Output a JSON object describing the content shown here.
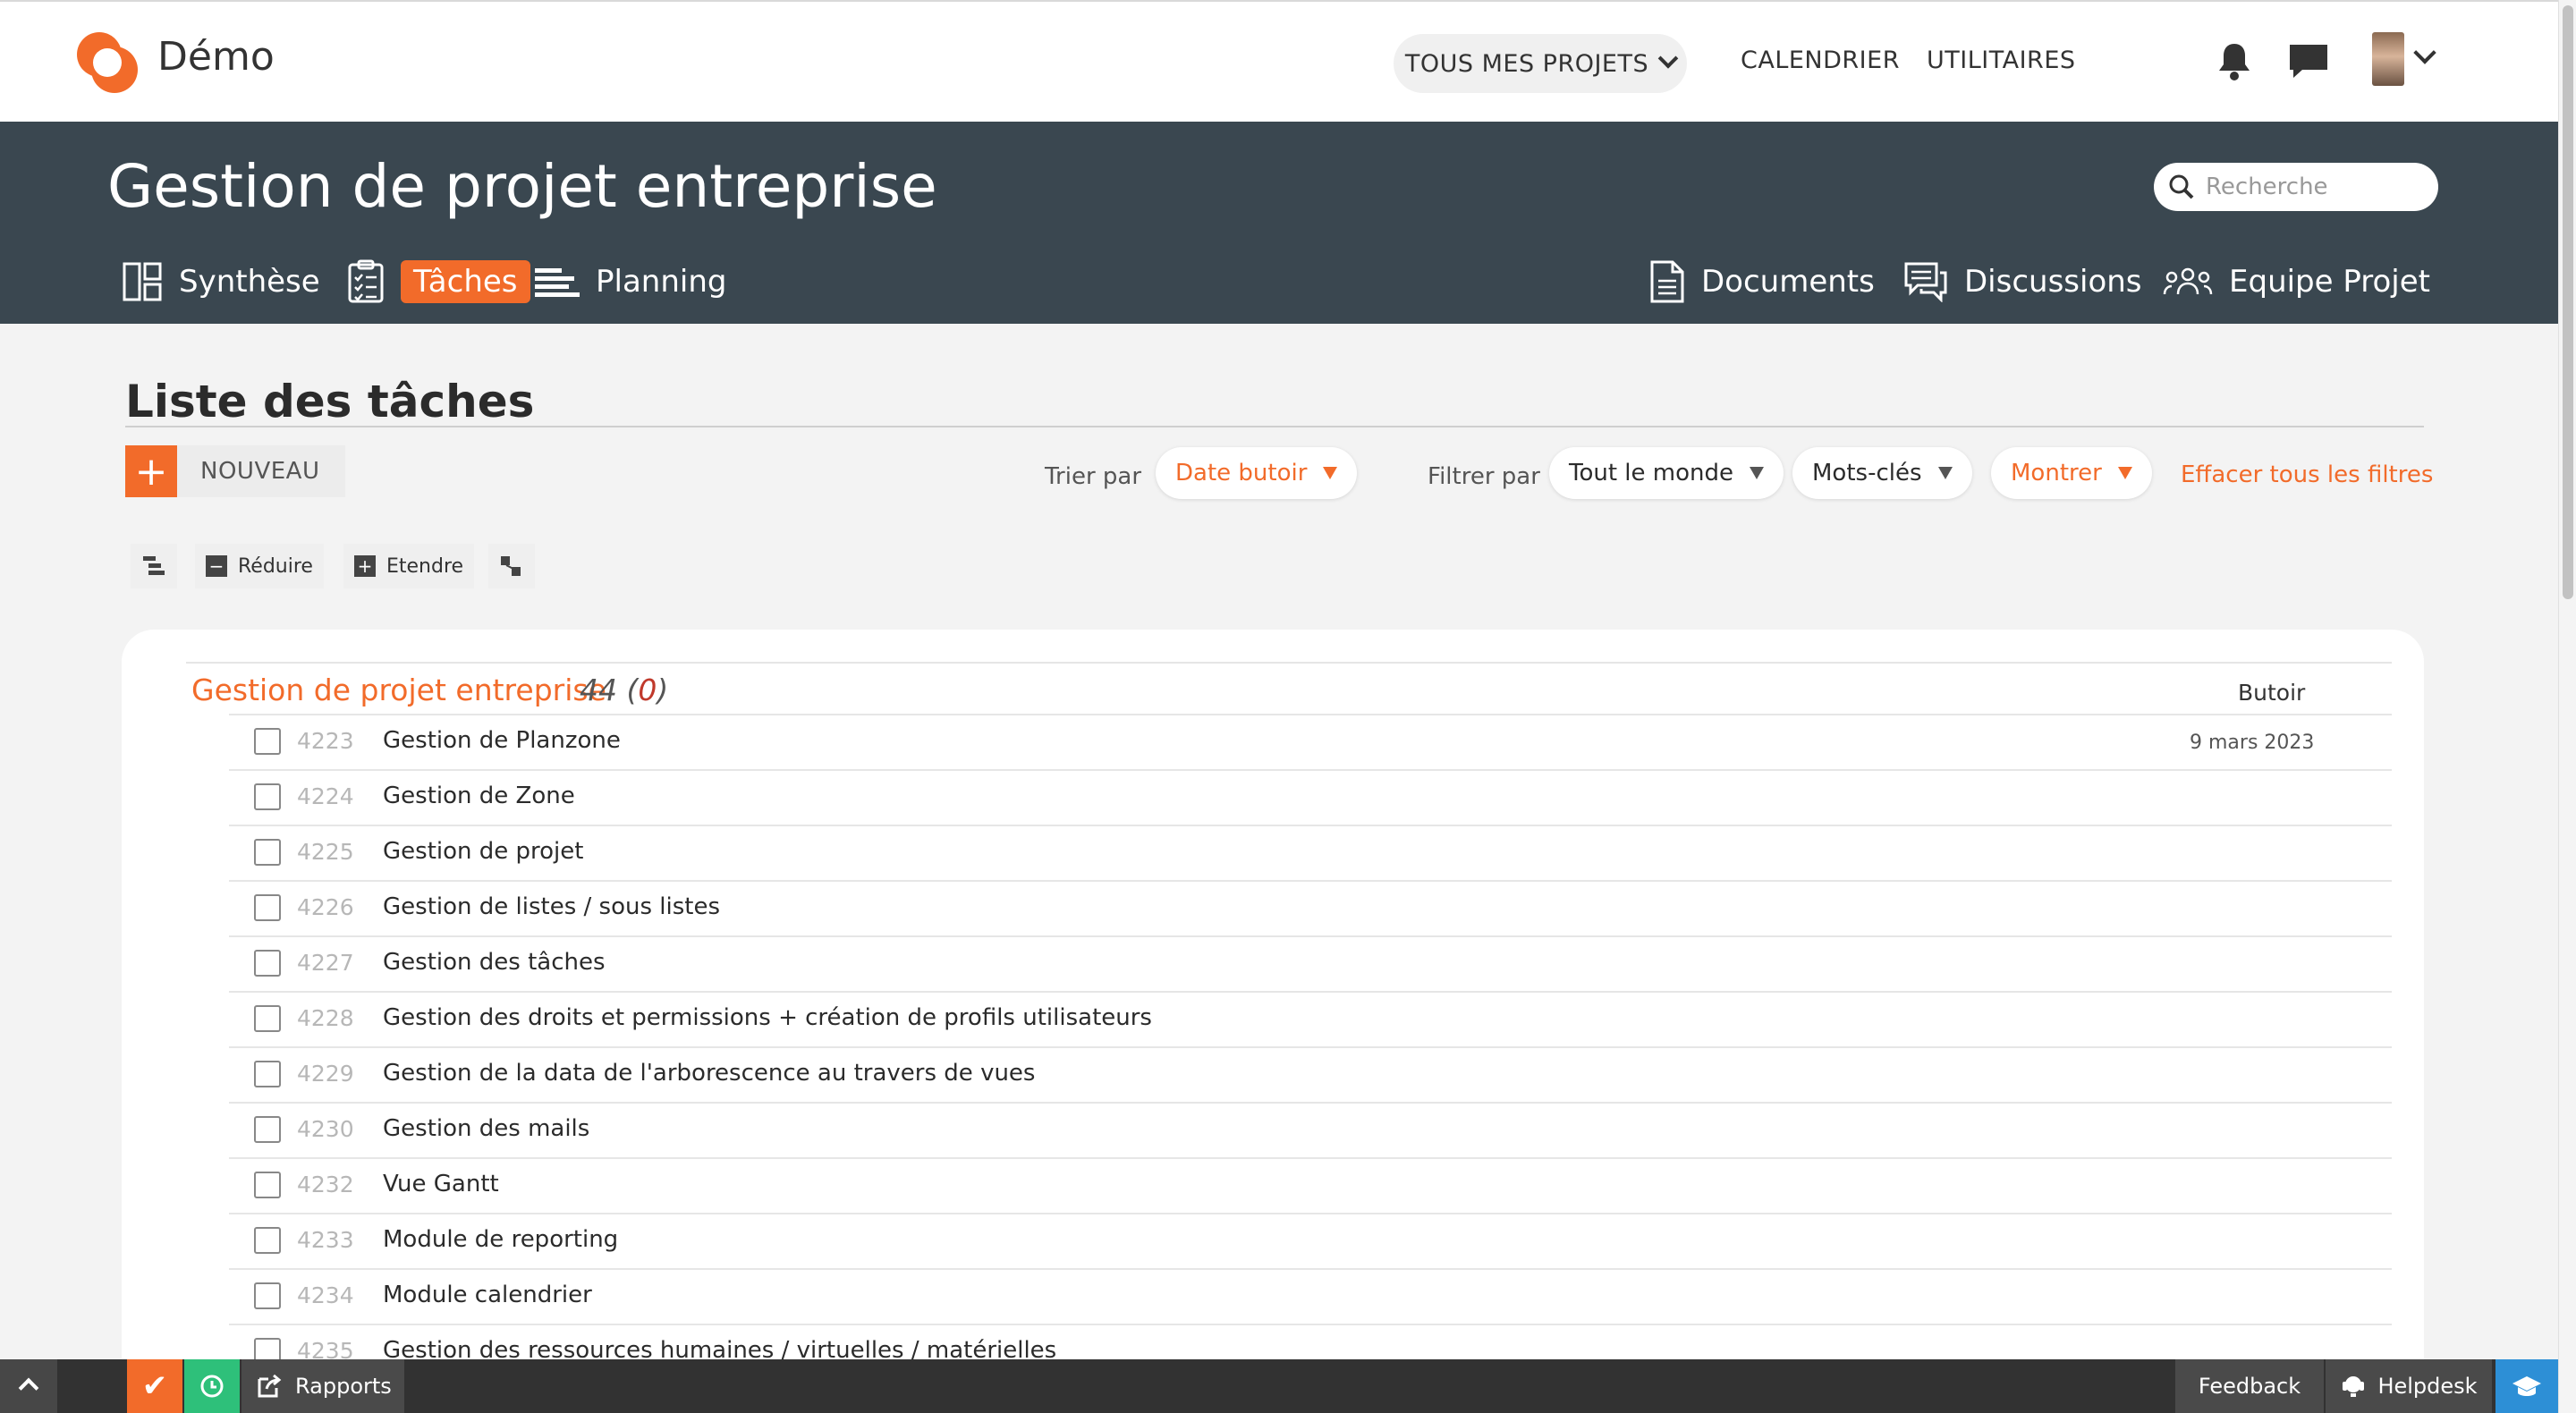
{
  "app": {
    "name": "Démo"
  },
  "topnav": {
    "projects_label": "TOUS MES PROJETS",
    "calendar_label": "CALENDRIER",
    "utilities_label": "UTILITAIRES"
  },
  "header": {
    "project_title": "Gestion de projet entreprise",
    "search_placeholder": "Recherche",
    "tabs": [
      {
        "label": "Synthèse",
        "icon": "dashboard-icon"
      },
      {
        "label": "Tâches",
        "icon": "checklist-icon",
        "active": true
      },
      {
        "label": "Planning",
        "icon": "gantt-icon"
      },
      {
        "label": "Documents",
        "icon": "document-icon"
      },
      {
        "label": "Discussions",
        "icon": "chat-icon"
      },
      {
        "label": "Equipe Projet",
        "icon": "team-icon"
      }
    ]
  },
  "task_list": {
    "title": "Liste des tâches",
    "new_label": "NOUVEAU",
    "sort_by_label": "Trier par",
    "sort_value": "Date butoir",
    "filter_by_label": "Filtrer par",
    "filter_people": "Tout le monde",
    "filter_keywords": "Mots-clés",
    "filter_show": "Montrer",
    "clear_filters": "Effacer tous les filtres",
    "tools": {
      "collapse_label": "Réduire",
      "expand_label": "Etendre"
    },
    "group": {
      "name": "Gestion de projet entreprise",
      "count": "44",
      "overdue": "0",
      "due_column": "Butoir"
    },
    "tasks": [
      {
        "id": "4223",
        "name": "Gestion de Planzone",
        "due": "9 mars 2023"
      },
      {
        "id": "4224",
        "name": "Gestion de Zone",
        "due": ""
      },
      {
        "id": "4225",
        "name": "Gestion de projet",
        "due": ""
      },
      {
        "id": "4226",
        "name": "Gestion de listes / sous listes",
        "due": ""
      },
      {
        "id": "4227",
        "name": "Gestion des tâches",
        "due": ""
      },
      {
        "id": "4228",
        "name": "Gestion des droits et permissions + création de profils utilisateurs",
        "due": ""
      },
      {
        "id": "4229",
        "name": "Gestion de la data de l'arborescence au travers de vues",
        "due": ""
      },
      {
        "id": "4230",
        "name": "Gestion des mails",
        "due": ""
      },
      {
        "id": "4232",
        "name": "Vue Gantt",
        "due": ""
      },
      {
        "id": "4233",
        "name": "Module de reporting",
        "due": ""
      },
      {
        "id": "4234",
        "name": "Module calendrier",
        "due": ""
      },
      {
        "id": "4235",
        "name": "Gestion des ressources humaines / virtuelles / matérielles",
        "due": ""
      }
    ]
  },
  "bottombar": {
    "reports_label": "Rapports",
    "feedback_label": "Feedback",
    "helpdesk_label": "Helpdesk"
  },
  "colors": {
    "accent": "#f26b2a",
    "header_bg": "#3a4750",
    "success": "#2ec07a",
    "info": "#2d8fd6"
  }
}
